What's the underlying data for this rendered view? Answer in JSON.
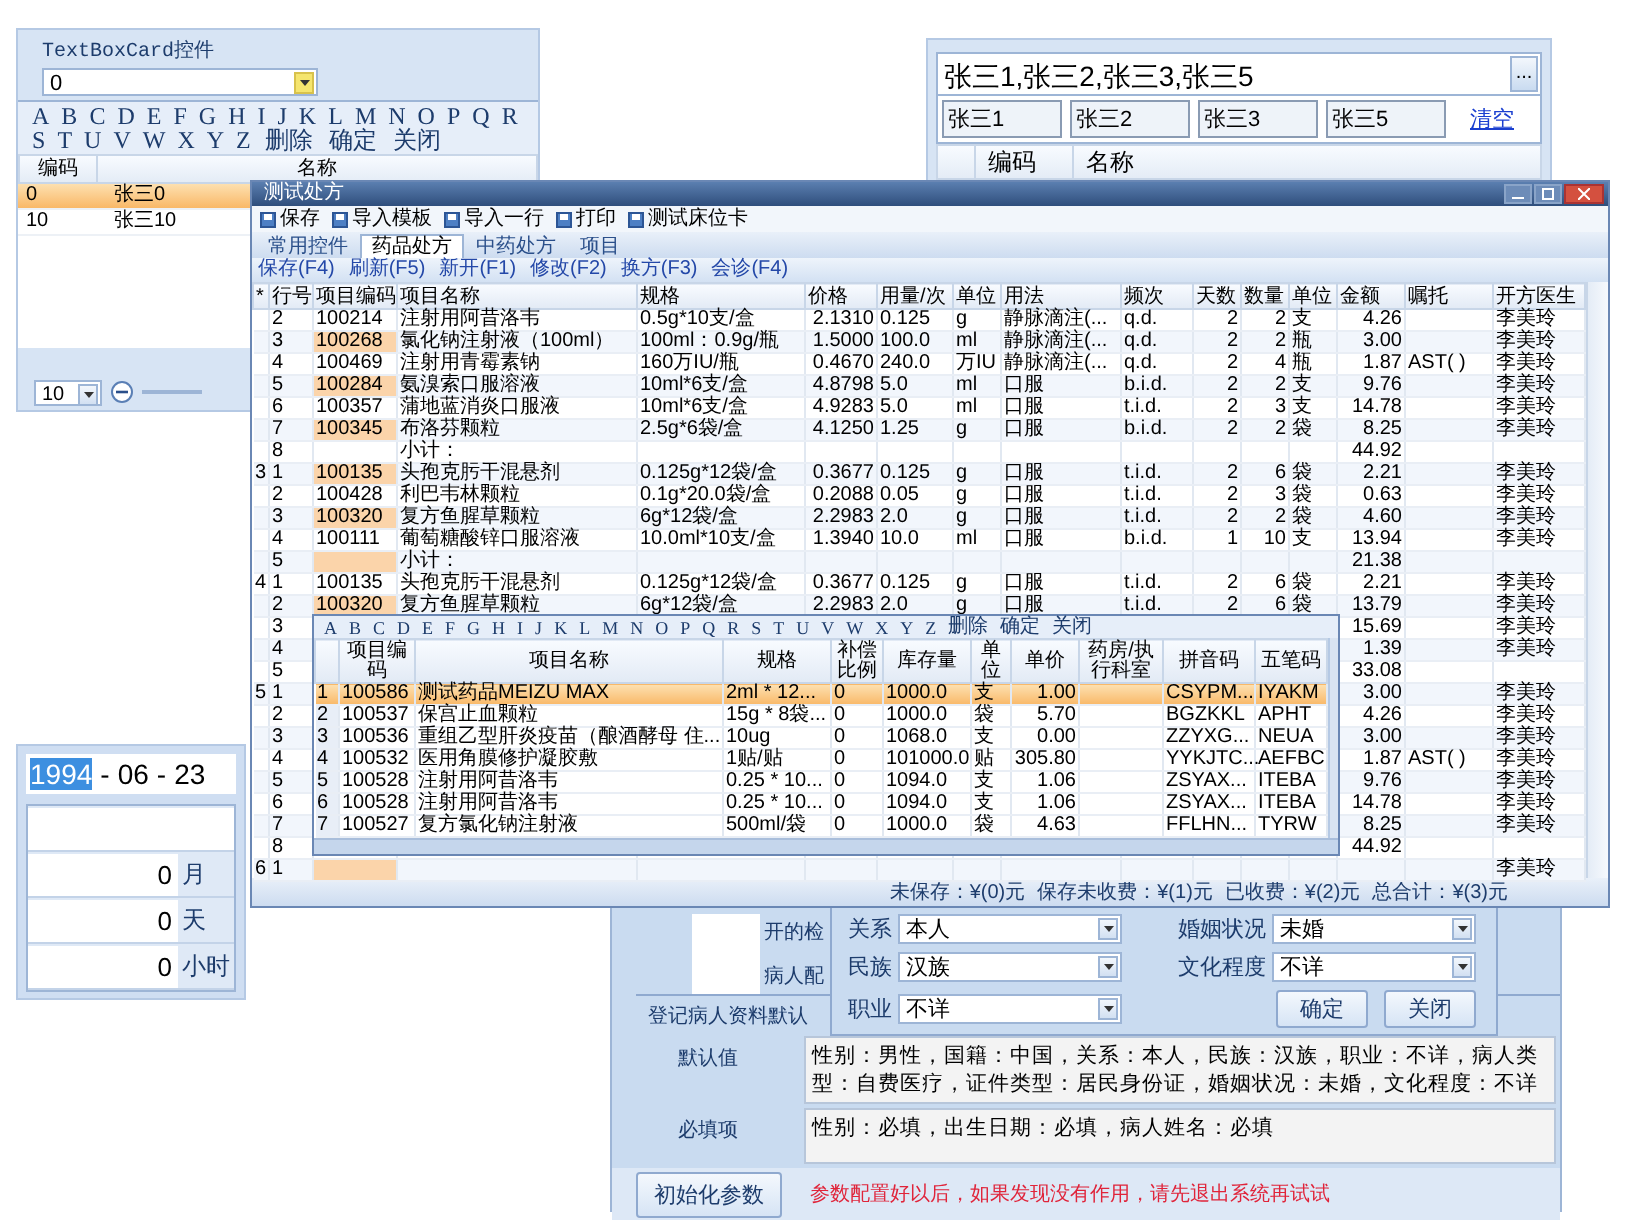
{
  "textbox_card": {
    "title": "TextBoxCard控件",
    "combo_value": "0",
    "letters": [
      "A",
      "B",
      "C",
      "D",
      "E",
      "F",
      "G",
      "H",
      "I",
      "J",
      "K",
      "L",
      "M",
      "N",
      "O",
      "P",
      "Q",
      "R",
      "S",
      "T",
      "U",
      "V",
      "W",
      "X",
      "Y",
      "Z"
    ],
    "actions": [
      "删除",
      "确定",
      "关闭"
    ],
    "columns": [
      "编码",
      "名称"
    ],
    "rows": [
      {
        "code": "0",
        "name": "张三0",
        "selected": true
      },
      {
        "code": "10",
        "name": "张三10",
        "selected": false
      }
    ],
    "page_size": "10"
  },
  "multi_select": {
    "value": "张三1,张三2,张三3,张三5",
    "button": "...",
    "tags": [
      "张三1",
      "张三2",
      "张三3",
      "张三5"
    ],
    "clear_link": "清空",
    "columns": [
      "编码",
      "名称"
    ]
  },
  "prescription": {
    "title": "测试处方",
    "toolbar": [
      "保存",
      "导入模板",
      "导入一行",
      "打印",
      "测试床位卡"
    ],
    "tabs": [
      {
        "label": "常用控件",
        "selected": false
      },
      {
        "label": "药品处方",
        "selected": true
      },
      {
        "label": "中药处方",
        "selected": false
      },
      {
        "label": "项目",
        "selected": false
      }
    ],
    "actions": [
      "保存(F4)",
      "刷新(F5)",
      "新开(F1)",
      "修改(F2)",
      "换方(F3)",
      "会诊(F4)"
    ],
    "columns": [
      "*",
      "行号",
      "项目编码",
      "项目名称",
      "规格",
      "价格",
      "用量/次",
      "单位",
      "用法",
      "频次",
      "天数",
      "数量",
      "单位",
      "金额",
      "嘱托",
      "开方医生"
    ],
    "rows": [
      {
        "code_highlight": false,
        "cells": [
          null,
          "2",
          "100214",
          "注射用阿昔洛韦",
          "0.5g*10支/盒",
          "2.1310",
          "0.125",
          "g",
          "静脉滴注(...",
          "q.d.",
          "2",
          "2",
          "支",
          "4.26",
          null,
          "李美玲"
        ]
      },
      {
        "code_highlight": true,
        "cells": [
          null,
          "3",
          "100268",
          "氯化钠注射液（100ml）",
          "100ml：0.9g/瓶",
          "1.5000",
          "100.0",
          "ml",
          "静脉滴注(...",
          "q.d.",
          "2",
          "2",
          "瓶",
          "3.00",
          null,
          "李美玲"
        ]
      },
      {
        "code_highlight": false,
        "cells": [
          null,
          "4",
          "100469",
          "注射用青霉素钠",
          "160万IU/瓶",
          "0.4670",
          "240.0",
          "万IU",
          "静脉滴注(...",
          "q.d.",
          "2",
          "4",
          "瓶",
          "1.87",
          "AST( )",
          "李美玲"
        ]
      },
      {
        "code_highlight": true,
        "cells": [
          null,
          "5",
          "100284",
          "氨溴索口服溶液",
          "10ml*6支/盒",
          "4.8798",
          "5.0",
          "ml",
          "口服",
          "b.i.d.",
          "2",
          "2",
          "支",
          "9.76",
          null,
          "李美玲"
        ]
      },
      {
        "code_highlight": false,
        "cells": [
          null,
          "6",
          "100357",
          "蒲地蓝消炎口服液",
          "10ml*6支/盒",
          "4.9283",
          "5.0",
          "ml",
          "口服",
          "t.i.d.",
          "2",
          "3",
          "支",
          "14.78",
          null,
          "李美玲"
        ]
      },
      {
        "code_highlight": true,
        "cells": [
          null,
          "7",
          "100345",
          "布洛芬颗粒",
          "2.5g*6袋/盒",
          "4.1250",
          "1.25",
          "g",
          "口服",
          "b.i.d.",
          "2",
          "2",
          "袋",
          "8.25",
          null,
          "李美玲"
        ]
      },
      {
        "code_highlight": false,
        "cells": [
          null,
          "8",
          null,
          "小计：",
          null,
          null,
          null,
          null,
          null,
          null,
          null,
          null,
          null,
          "44.92",
          null,
          null
        ]
      },
      {
        "code_highlight": true,
        "cells": [
          "3",
          "1",
          "100135",
          "头孢克肟干混悬剂",
          "0.125g*12袋/盒",
          "0.3677",
          "0.125",
          "g",
          "口服",
          "t.i.d.",
          "2",
          "6",
          "袋",
          "2.21",
          null,
          "李美玲"
        ]
      },
      {
        "code_highlight": false,
        "cells": [
          null,
          "2",
          "100428",
          "利巴韦林颗粒",
          "0.1g*20.0袋/盒",
          "0.2088",
          "0.05",
          "g",
          "口服",
          "t.i.d.",
          "2",
          "3",
          "袋",
          "0.63",
          null,
          "李美玲"
        ]
      },
      {
        "code_highlight": true,
        "cells": [
          null,
          "3",
          "100320",
          "复方鱼腥草颗粒",
          "6g*12袋/盒",
          "2.2983",
          "2.0",
          "g",
          "口服",
          "t.i.d.",
          "2",
          "2",
          "袋",
          "4.60",
          null,
          "李美玲"
        ]
      },
      {
        "code_highlight": false,
        "cells": [
          null,
          "4",
          "100111",
          "葡萄糖酸锌口服溶液",
          "10.0ml*10支/盒",
          "1.3940",
          "10.0",
          "ml",
          "口服",
          "b.i.d.",
          "1",
          "10",
          "支",
          "13.94",
          null,
          "李美玲"
        ]
      },
      {
        "code_highlight": true,
        "cells": [
          null,
          "5",
          null,
          "小计：",
          null,
          null,
          null,
          null,
          null,
          null,
          null,
          null,
          null,
          "21.38",
          null,
          null
        ]
      },
      {
        "code_highlight": false,
        "cells": [
          "4",
          "1",
          "100135",
          "头孢克肟干混悬剂",
          "0.125g*12袋/盒",
          "0.3677",
          "0.125",
          "g",
          "口服",
          "t.i.d.",
          "2",
          "6",
          "袋",
          "2.21",
          null,
          "李美玲"
        ]
      },
      {
        "code_highlight": true,
        "cells": [
          null,
          "2",
          "100320",
          "复方鱼腥草颗粒",
          "6g*12袋/盒",
          "2.2983",
          "2.0",
          "g",
          "口服",
          "t.i.d.",
          "2",
          "6",
          "袋",
          "13.79",
          null,
          "李美玲"
        ]
      },
      {
        "cells": [
          null,
          "3",
          null,
          null,
          null,
          null,
          null,
          null,
          null,
          null,
          null,
          null,
          null,
          "15.69",
          null,
          "李美玲"
        ]
      },
      {
        "cells": [
          null,
          "4",
          null,
          null,
          null,
          null,
          null,
          null,
          null,
          null,
          null,
          null,
          null,
          "1.39",
          null,
          "李美玲"
        ]
      },
      {
        "cells": [
          null,
          "5",
          null,
          null,
          null,
          null,
          null,
          null,
          null,
          null,
          null,
          null,
          null,
          "33.08",
          null,
          null
        ]
      },
      {
        "cells": [
          "5",
          "1",
          null,
          null,
          null,
          null,
          null,
          null,
          null,
          null,
          null,
          null,
          null,
          "3.00",
          null,
          "李美玲"
        ]
      },
      {
        "cells": [
          null,
          "2",
          null,
          null,
          null,
          null,
          null,
          null,
          null,
          null,
          null,
          null,
          null,
          "4.26",
          null,
          "李美玲"
        ]
      },
      {
        "cells": [
          null,
          "3",
          null,
          null,
          null,
          null,
          null,
          null,
          null,
          null,
          null,
          null,
          null,
          "3.00",
          null,
          "李美玲"
        ]
      },
      {
        "cells": [
          null,
          "4",
          null,
          null,
          null,
          null,
          null,
          null,
          null,
          null,
          null,
          null,
          null,
          "1.87",
          "AST( )",
          "李美玲"
        ]
      },
      {
        "cells": [
          null,
          "5",
          null,
          null,
          null,
          null,
          null,
          null,
          null,
          null,
          null,
          null,
          null,
          "9.76",
          null,
          "李美玲"
        ]
      },
      {
        "cells": [
          null,
          "6",
          null,
          null,
          null,
          null,
          null,
          null,
          null,
          null,
          null,
          null,
          null,
          "14.78",
          null,
          "李美玲"
        ]
      },
      {
        "cells": [
          null,
          "7",
          null,
          null,
          null,
          null,
          null,
          null,
          null,
          null,
          null,
          null,
          null,
          "8.25",
          null,
          "李美玲"
        ]
      },
      {
        "cells": [
          null,
          "8",
          null,
          null,
          null,
          null,
          null,
          null,
          null,
          null,
          null,
          null,
          null,
          "44.92",
          null,
          null
        ]
      },
      {
        "code_highlight": true,
        "cells": [
          "6",
          "1",
          null,
          null,
          null,
          null,
          null,
          null,
          null,
          null,
          null,
          null,
          null,
          null,
          null,
          "李美玲"
        ]
      }
    ],
    "status": [
      "未保存：¥(0)元",
      "保存未收费：¥(1)元",
      "已收费：¥(2)元",
      "总合计：¥(3)元"
    ]
  },
  "item_picker": {
    "letters": [
      "A",
      "B",
      "C",
      "D",
      "E",
      "F",
      "G",
      "H",
      "I",
      "J",
      "K",
      "L",
      "M",
      "N",
      "O",
      "P",
      "Q",
      "R",
      "S",
      "T",
      "U",
      "V",
      "W",
      "X",
      "Y",
      "Z"
    ],
    "actions": [
      "删除",
      "确定",
      "关闭"
    ],
    "columns": [
      "项目编码",
      "项目名称",
      "规格",
      "补偿比例",
      "库存量",
      "单位",
      "单价",
      "药房/执行科室",
      "拼音码",
      "五笔码"
    ],
    "rows": [
      {
        "index": "1",
        "selected": true,
        "cells": [
          "100586",
          "测试药品MEIZU MAX",
          "2ml * 12...",
          "0",
          "1000.0",
          "支",
          "1.00",
          null,
          "CSYPM...",
          "IYAKM"
        ]
      },
      {
        "index": "2",
        "selected": false,
        "cells": [
          "100537",
          "保宫止血颗粒",
          "15g * 8袋...",
          "0",
          "1000.0",
          "袋",
          "5.70",
          null,
          "BGZKKL",
          "APHT"
        ]
      },
      {
        "index": "3",
        "selected": false,
        "cells": [
          "100536",
          "重组乙型肝炎疫苗（酿酒酵母 住...",
          "10ug",
          "0",
          "1068.0",
          "支",
          "0.00",
          null,
          "ZZYXG...",
          "NEUA"
        ]
      },
      {
        "index": "4",
        "selected": false,
        "cells": [
          "100532",
          "医用角膜修护凝胶敷",
          "1贴/贴",
          "0",
          "101000.0",
          "贴",
          "305.80",
          null,
          "YYKJTC...",
          "AEFBC"
        ]
      },
      {
        "index": "5",
        "selected": false,
        "cells": [
          "100528",
          "注射用阿昔洛韦",
          "0.25 * 10...",
          "0",
          "1094.0",
          "支",
          "1.06",
          null,
          "ZSYAX...",
          "ITEBA"
        ]
      },
      {
        "index": "6",
        "selected": false,
        "cells": [
          "100528",
          "注射用阿昔洛韦",
          "0.25 * 10...",
          "0",
          "1094.0",
          "支",
          "1.06",
          null,
          "ZSYAX...",
          "ITEBA"
        ]
      },
      {
        "index": "7",
        "selected": false,
        "cells": [
          "100527",
          "复方氯化钠注射液",
          "500ml/袋",
          "0",
          "1000.0",
          "袋",
          "4.63",
          null,
          "FFLHN...",
          "TYRW"
        ]
      }
    ]
  },
  "date_window": {
    "date_parts": [
      {
        "text": "1994",
        "selected": true
      },
      {
        "text": "-",
        "selected": false
      },
      {
        "text": "06",
        "selected": false
      },
      {
        "text": "-",
        "selected": false
      },
      {
        "text": "23",
        "selected": false
      }
    ],
    "fields": [
      {
        "value": "0",
        "unit": "月"
      },
      {
        "value": "0",
        "unit": "天"
      },
      {
        "value": "0",
        "unit": "小时"
      }
    ]
  },
  "patient_dialog": {
    "fields": [
      {
        "label": "关系",
        "value": "本人"
      },
      {
        "label": "婚姻状况",
        "value": "未婚"
      },
      {
        "label": "民族",
        "value": "汉族"
      },
      {
        "label": "文化程度",
        "value": "不详"
      },
      {
        "label": "职业",
        "value": "不详"
      }
    ],
    "buttons": [
      "确定",
      "关闭"
    ]
  },
  "config_window": {
    "labels": [
      "开的检",
      "病人配"
    ],
    "section_label": "登记病人资料默认",
    "default_label": "默认值",
    "default_value": "性别：男性，国籍：中国，关系：本人，民族：汉族，职业：不详，病人类型：自费医疗，证件类型：居民身份证，婚姻状况：未婚，文化程度：不详",
    "required_label": "必填项",
    "required_value": "性别：必填，出生日期：必填，病人姓名：必填",
    "init_button": "初始化参数",
    "warning": "参数配置好以后，如果发现没有作用，请先退出系统再试试"
  }
}
